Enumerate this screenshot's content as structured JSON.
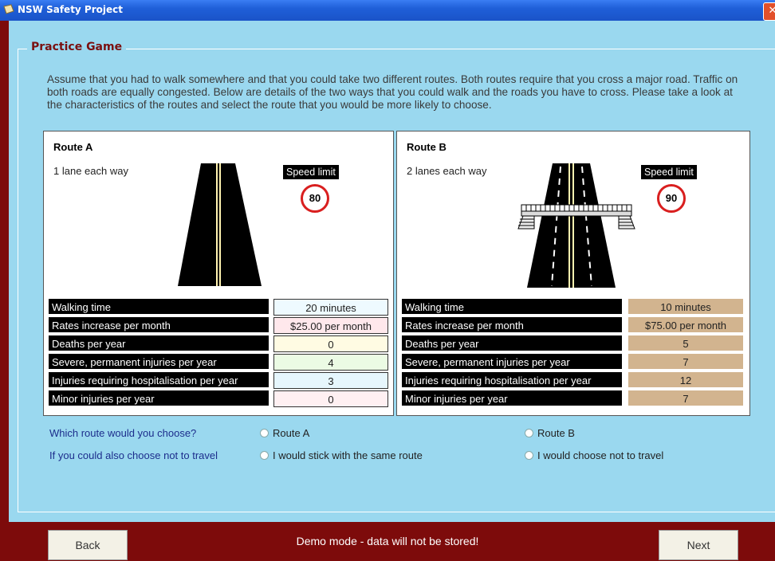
{
  "window": {
    "title": "NSW Safety Project",
    "close_label": "✕"
  },
  "group": {
    "legend": "Practice Game"
  },
  "intro": "Assume that you had to walk somewhere and that you could take two different routes. Both routes require that you cross a major road. Traffic on both roads are equally congested. Below are details of the two ways that you could walk and the roads you have to cross. Please take a look at the characteristics of the routes and select the route that you would be more likely to choose.",
  "route_a": {
    "title": "Route A",
    "lanes": "1 lane each way",
    "speed_label": "Speed limit",
    "speed": "80",
    "rows": [
      {
        "label": "Walking time",
        "value": "20 minutes",
        "color": "#eefaff"
      },
      {
        "label": "Rates increase per month",
        "value": "$25.00 per month",
        "color": "#ffe8ec"
      },
      {
        "label": "Deaths per year",
        "value": "0",
        "color": "#fffbe3"
      },
      {
        "label": "Severe, permanent injuries per year",
        "value": "4",
        "color": "#ebfbe4"
      },
      {
        "label": "Injuries requiring hospitalisation per year",
        "value": "3",
        "color": "#e6f6fd"
      },
      {
        "label": "Minor injuries per year",
        "value": "0",
        "color": "#fff0f2"
      }
    ]
  },
  "route_b": {
    "title": "Route B",
    "lanes": "2 lanes each way",
    "speed_label": "Speed limit",
    "speed": "90",
    "rows": [
      {
        "label": "Walking time",
        "value": "10 minutes"
      },
      {
        "label": "Rates increase per month",
        "value": "$75.00 per month"
      },
      {
        "label": "Deaths per year",
        "value": "5"
      },
      {
        "label": "Severe, permanent injuries per year",
        "value": "7"
      },
      {
        "label": "Injuries requiring hospitalisation per year",
        "value": "12"
      },
      {
        "label": "Minor injuries per year",
        "value": "7"
      }
    ]
  },
  "questions": {
    "q1": "Which route would you choose?",
    "q1_opt_a": "Route A",
    "q1_opt_b": "Route B",
    "q2": "If you could also choose not to travel",
    "q2_opt_a": "I would stick with the same route",
    "q2_opt_b": "I would choose not to travel"
  },
  "footer": {
    "back": "Back",
    "next": "Next",
    "demo": "Demo mode - data will not be stored!"
  },
  "colors": {
    "frame": "#7d0b0b",
    "background": "#9ad8ef",
    "legend": "#7a1010",
    "route_b_cell": "#d2b48f"
  }
}
